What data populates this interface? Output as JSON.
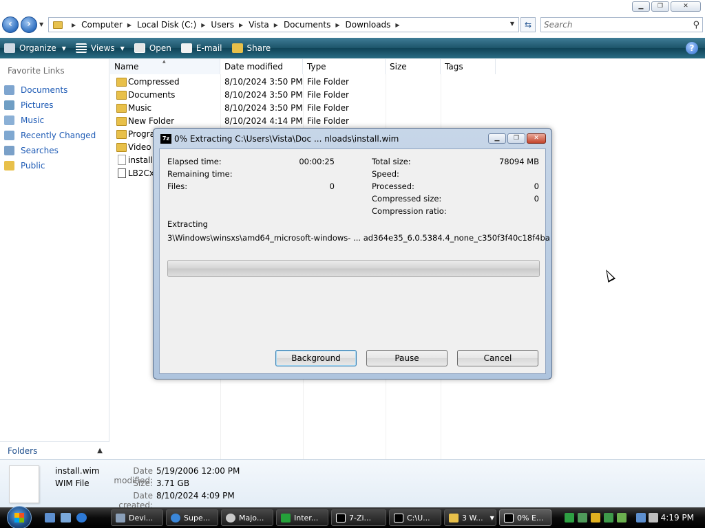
{
  "address": {
    "breadcrumbs": [
      "Computer",
      "Local Disk (C:)",
      "Users",
      "Vista",
      "Documents",
      "Downloads"
    ],
    "search_placeholder": "Search"
  },
  "toolbar": {
    "organize": "Organize",
    "views": "Views",
    "open": "Open",
    "email": "E-mail",
    "share": "Share"
  },
  "nav": {
    "heading": "Favorite Links",
    "items": [
      "Documents",
      "Pictures",
      "Music",
      "Recently Changed",
      "Searches",
      "Public"
    ],
    "folders_label": "Folders"
  },
  "files": {
    "columns": [
      "Name",
      "Date modified",
      "Type",
      "Size",
      "Tags"
    ],
    "rows": [
      {
        "name": "Compressed",
        "date": "8/10/2024 3:50 PM",
        "type": "File Folder"
      },
      {
        "name": "Documents",
        "date": "8/10/2024 3:50 PM",
        "type": "File Folder"
      },
      {
        "name": "Music",
        "date": "8/10/2024 3:50 PM",
        "type": "File Folder"
      },
      {
        "name": "New Folder",
        "date": "8/10/2024 4:14 PM",
        "type": "File Folder"
      },
      {
        "name": "Progra",
        "date": "",
        "type": ""
      },
      {
        "name": "Video",
        "date": "",
        "type": ""
      },
      {
        "name": "install.",
        "date": "",
        "type": ""
      },
      {
        "name": "LB2CxF",
        "date": "",
        "type": ""
      }
    ]
  },
  "details": {
    "name": "install.wim",
    "type": "WIM File",
    "date_modified_label": "Date modified:",
    "date_modified": "5/19/2006 12:00 PM",
    "size_label": "Size:",
    "size": "3.71 GB",
    "date_created_label": "Date created:",
    "date_created": "8/10/2024 4:09 PM"
  },
  "dialog": {
    "title": "0% Extracting C:\\Users\\Vista\\Doc ... nloads\\install.wim",
    "elapsed_label": "Elapsed time:",
    "elapsed": "00:00:25",
    "remaining_label": "Remaining time:",
    "files_label": "Files:",
    "files": "0",
    "total_size_label": "Total size:",
    "total_size": "78094 MB",
    "speed_label": "Speed:",
    "processed_label": "Processed:",
    "processed": "0",
    "compressed_size_label": "Compressed size:",
    "compressed_size": "0",
    "compression_ratio_label": "Compression ratio:",
    "extracting_label": "Extracting",
    "current_path": "3\\Windows\\winsxs\\amd64_microsoft-windows- ... ad364e35_6.0.5384.4_none_c350f3f40c18f4ba",
    "progress_fraction": 0,
    "buttons": {
      "background": "Background",
      "pause": "Pause",
      "cancel": "Cancel"
    }
  },
  "taskbar": {
    "tasks": [
      "Devi...",
      "Supe...",
      "Majo...",
      "Inter...",
      "7-Zi...",
      "C:\\U...",
      "3 W...",
      "0% E..."
    ],
    "clock": "4:19 PM"
  },
  "colors": {
    "toolbar": "#1c5469",
    "link": "#1e5bb5",
    "folder": "#e8c04a",
    "progress_fill": "#2fbb2f"
  }
}
